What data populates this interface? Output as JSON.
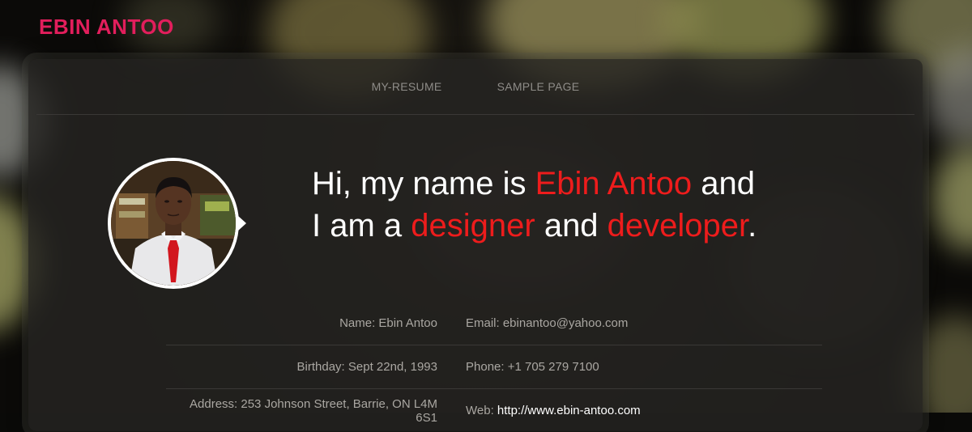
{
  "brand": {
    "name": "EBIN ANTOO"
  },
  "nav": {
    "items": [
      {
        "label": "MY-RESUME"
      },
      {
        "label": "SAMPLE PAGE"
      }
    ]
  },
  "intro": {
    "line1_prefix": "Hi, my name is ",
    "name": "Ebin Antoo",
    "line1_suffix": " and",
    "line2_prefix": "I am a ",
    "role1": "designer",
    "line2_mid": " and ",
    "role2": "developer",
    "line2_suffix": "."
  },
  "info": {
    "rows": [
      {
        "left": "Name: Ebin Antoo",
        "right_label": "Email: ",
        "right_value": "ebinantoo@yahoo.com"
      },
      {
        "left": "Birthday: Sept 22nd, 1993",
        "right_label": "Phone: ",
        "right_value": "+1 705 279 7100"
      },
      {
        "left": "Address: 253 Johnson Street, Barrie, ON L4M 6S1",
        "right_label": "Web: ",
        "right_value": "http://www.ebin-antoo.com"
      }
    ]
  },
  "colors": {
    "brand": "#e21e5c",
    "highlight": "#ee1c1c",
    "panel": "#262422",
    "text_muted": "#aaa7a2"
  }
}
